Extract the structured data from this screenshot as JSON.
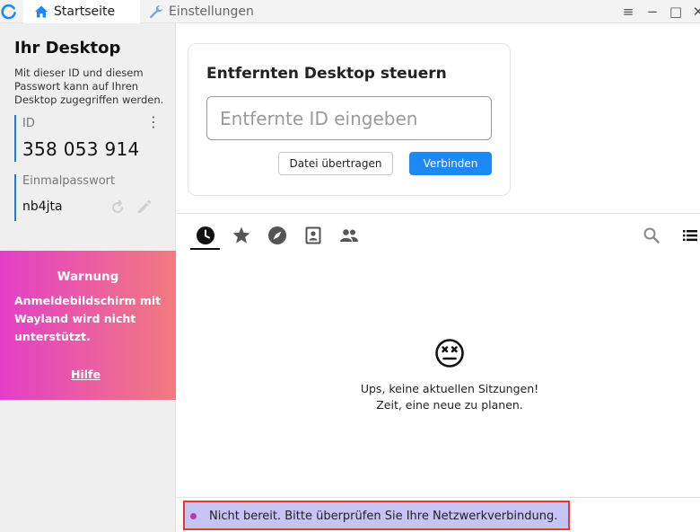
{
  "titlebar": {
    "tabs": [
      {
        "label": "Startseite",
        "icon": "home-icon",
        "active": true
      },
      {
        "label": "Einstellungen",
        "icon": "wrench-icon",
        "active": false
      }
    ],
    "window_controls": {
      "menu": "≡",
      "minimize": "−",
      "maximize": "□",
      "close": "✕"
    }
  },
  "left_panel": {
    "title": "Ihr Desktop",
    "description": "Mit dieser ID und diesem Passwort kann auf Ihren Desktop zugegriffen werden.",
    "id_label": "ID",
    "id_value": "358 053 914",
    "password_label": "Einmalpasswort",
    "password_value": "nb4jta"
  },
  "warning": {
    "title": "Warnung",
    "text": "Anmeldebildschirm mit Wayland wird nicht unterstützt.",
    "link": "Hilfe"
  },
  "remote": {
    "title": "Entfernten Desktop steuern",
    "placeholder": "Entfernte ID eingeben",
    "value": "",
    "transfer_button": "Datei übertragen",
    "connect_button": "Verbinden"
  },
  "session_tabs": [
    {
      "icon": "clock-icon",
      "name": "recent",
      "active": true
    },
    {
      "icon": "star-icon",
      "name": "favorites",
      "active": false
    },
    {
      "icon": "compass-icon",
      "name": "discovered",
      "active": false
    },
    {
      "icon": "address-book-icon",
      "name": "address-book",
      "active": false
    },
    {
      "icon": "group-icon",
      "name": "group",
      "active": false
    }
  ],
  "empty_state": {
    "line1": "Ups, keine aktuellen Sitzungen!",
    "line2": "Zeit, eine neue zu planen."
  },
  "status": {
    "text": "Nicht bereit. Bitte überprüfen Sie Ihre Netzwerkverbindung."
  },
  "colors": {
    "accent": "#1e88f5",
    "warning_start": "#e33fc6",
    "warning_end": "#f27a7f",
    "status_bg": "#c5c4f5",
    "status_dot": "#b33bb0"
  }
}
